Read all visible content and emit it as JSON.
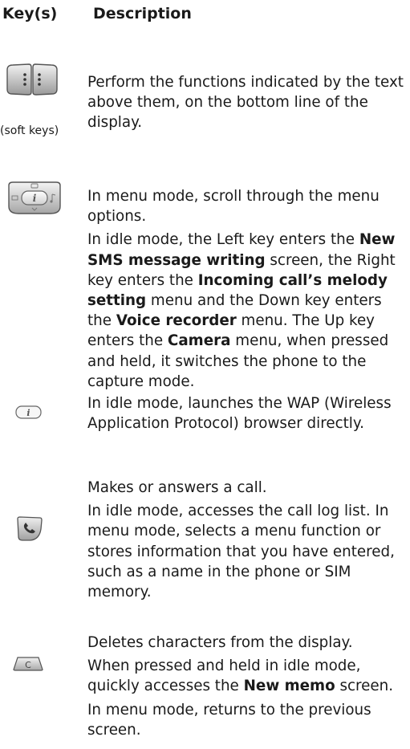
{
  "header": {
    "keys": "Key(s)",
    "description": "Description"
  },
  "rows": [
    {
      "icon": "soft-keys-icon",
      "caption": "(soft keys)",
      "paragraphs": [
        [
          {
            "t": "Perform the functions indicated by the text above them, on the bottom line of the display."
          }
        ]
      ]
    },
    {
      "icon": "navigation-keys-icon",
      "paragraphs": [
        [
          {
            "t": "In menu mode, scroll through the menu options."
          }
        ],
        [
          {
            "t": "In idle mode, the Left key enters the "
          },
          {
            "t": "New SMS message writing",
            "b": true
          },
          {
            "t": " screen, the Right key enters the "
          },
          {
            "t": "Incoming call’s melody setting",
            "b": true
          },
          {
            "t": " menu and the Down key enters the "
          },
          {
            "t": "Voice recorder",
            "b": true
          },
          {
            "t": " menu. The Up key enters the "
          },
          {
            "t": "Camera",
            "b": true
          },
          {
            "t": " menu, when pressed and held, it switches the phone to the capture mode."
          }
        ]
      ]
    },
    {
      "icon": "wap-key-icon",
      "paragraphs": [
        [
          {
            "t": "In idle mode, launches the WAP (Wireless Application Protocol) browser directly."
          }
        ]
      ]
    },
    {
      "icon": "dial-key-icon",
      "paragraphs": [
        [
          {
            "t": "Makes or answers a call."
          }
        ],
        [
          {
            "t": "In idle mode, accesses the call log list. In menu mode, selects a menu function or stores information that you have entered, such as a name in the phone or SIM memory."
          }
        ]
      ]
    },
    {
      "icon": "clear-key-icon",
      "icon_label": "C",
      "paragraphs": [
        [
          {
            "t": "Deletes characters from the display."
          }
        ],
        [
          {
            "t": "When pressed and held in idle mode, quickly accesses the "
          },
          {
            "t": "New memo",
            "b": true
          },
          {
            "t": " screen."
          }
        ],
        [
          {
            "t": "In menu mode, returns to the previous screen."
          }
        ]
      ]
    }
  ]
}
